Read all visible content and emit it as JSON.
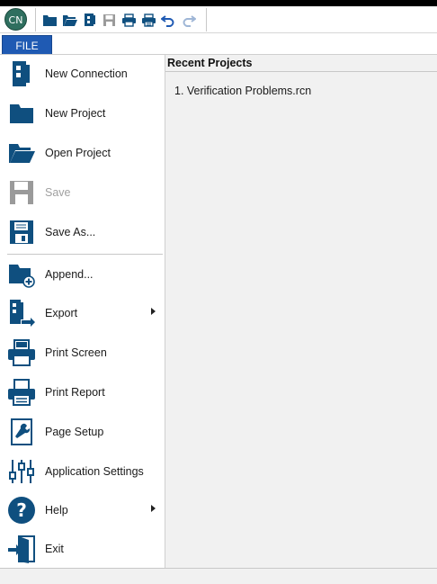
{
  "app": {
    "logo_text": "CN"
  },
  "quick_access": {
    "icons": [
      "new-project-icon",
      "open-folder-icon",
      "new-connection-icon",
      "save-icon",
      "print-screen-icon",
      "print-report-icon",
      "undo-icon",
      "redo-icon"
    ]
  },
  "ribbon": {
    "file_tab": "FILE"
  },
  "menu": {
    "items": [
      {
        "label": "New Connection",
        "icon": "new-connection-icon",
        "enabled": true
      },
      {
        "label": "New Project",
        "icon": "new-project-icon",
        "enabled": true
      },
      {
        "label": "Open Project",
        "icon": "open-project-icon",
        "enabled": true
      },
      {
        "label": "Save",
        "icon": "save-icon",
        "enabled": false
      },
      {
        "label": "Save As...",
        "icon": "save-as-icon",
        "enabled": true
      },
      {
        "label": "Append...",
        "icon": "append-icon",
        "enabled": true
      },
      {
        "label": "Export",
        "icon": "export-icon",
        "enabled": true,
        "submenu": true
      },
      {
        "label": "Print Screen",
        "icon": "print-screen-icon",
        "enabled": true
      },
      {
        "label": "Print Report",
        "icon": "print-report-icon",
        "enabled": true
      },
      {
        "label": "Page Setup",
        "icon": "page-setup-icon",
        "enabled": true
      },
      {
        "label": "Application Settings",
        "icon": "settings-sliders-icon",
        "enabled": true
      },
      {
        "label": "Help",
        "icon": "help-icon",
        "enabled": true,
        "submenu": true
      },
      {
        "label": "Exit",
        "icon": "exit-icon",
        "enabled": true
      }
    ]
  },
  "recent": {
    "title": "Recent Projects",
    "items": [
      "1. Verification Problems.rcn"
    ]
  },
  "colors": {
    "accent": "#1f5ab3",
    "icon_blue": "#0f4f7f",
    "disabled": "#a0a0a0",
    "panel_bg": "#f1f1f1"
  }
}
